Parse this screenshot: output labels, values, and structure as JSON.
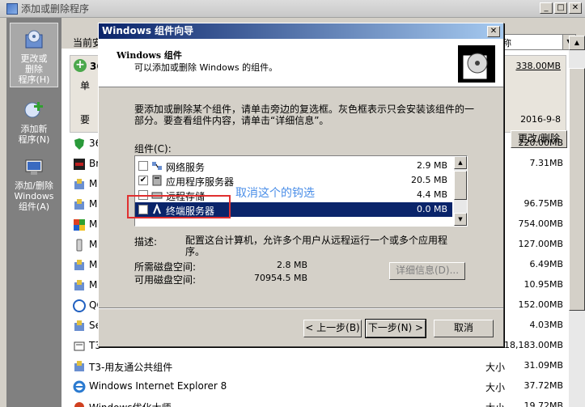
{
  "window": {
    "title": "添加或删除程序"
  },
  "sidebar": {
    "items": [
      {
        "label": "更改或\n删除\n程序(H)"
      },
      {
        "label": "添加新\n程序(N)"
      },
      {
        "label": "添加/删除\nWindows\n组件(A)"
      }
    ]
  },
  "main": {
    "sort_label": "当前安",
    "sort_value": "称",
    "selected_program": {
      "name_visible": "36",
      "size": "338.00MB",
      "date": "2016-9-8",
      "side_text_1": "单",
      "side_text_2": "要",
      "change_button": "更改/删除"
    },
    "programs": [
      {
        "name": "36",
        "label": "",
        "size": "220.00MB"
      },
      {
        "name": "Br",
        "label": "",
        "size": "7.31MB"
      },
      {
        "name": "Ma",
        "label": "",
        "size": ""
      },
      {
        "name": "Mi",
        "label": "",
        "size": "96.75MB"
      },
      {
        "name": "Mi",
        "label": "",
        "size": "754.00MB"
      },
      {
        "name": "Mi",
        "label": "",
        "size": "127.00MB"
      },
      {
        "name": "Mi",
        "label": "",
        "size": "6.49MB"
      },
      {
        "name": "Mi",
        "label": "",
        "size": "10.95MB"
      },
      {
        "name": "QC",
        "label": "",
        "size": "152.00MB"
      },
      {
        "name": "Se",
        "label": "",
        "size": "4.03MB"
      },
      {
        "name": "T3",
        "label": "",
        "size": "18,183.00MB"
      },
      {
        "name": "T3-用友通公共组件",
        "label": "大小",
        "size": "31.09MB"
      },
      {
        "name": "Windows Internet Explorer 8",
        "label": "大小",
        "size": "37.72MB"
      },
      {
        "name": "Windows优化大师",
        "label": "大小",
        "size": "19.72MB"
      }
    ]
  },
  "dialog": {
    "title": "Windows 组件向导",
    "header_title": "Windows 组件",
    "header_subtitle": "可以添加或删除 Windows 的组件。",
    "instructions": "要添加或删除某个组件，请单击旁边的复选框。灰色框表示只会安装该组件的一部分。要查看组件内容，请单击“详细信息”。",
    "components_label": "组件(C):",
    "components": [
      {
        "name": "网络服务",
        "size": "2.9 MB",
        "checked": ""
      },
      {
        "name": "应用程序服务器",
        "size": "20.5 MB",
        "checked": "✔"
      },
      {
        "name": "远程存储",
        "size": "4.4 MB",
        "checked": ""
      },
      {
        "name": "终端服务器",
        "size": "0.0 MB",
        "checked": ""
      }
    ],
    "description_label": "描述:",
    "description": "配置这台计算机，允许多个用户从远程运行一个或多个应用程序。",
    "disk_required_label": "所需磁盘空间:",
    "disk_required": "2.8 MB",
    "disk_available_label": "可用磁盘空间:",
    "disk_available": "70954.5 MB",
    "details_button": "详细信息(D)...",
    "back_button": "< 上一步(B)",
    "next_button": "下一步(N) >",
    "cancel_button": "取消"
  },
  "annotation": {
    "text": "取消这个的钩选",
    "color": "#e03030"
  }
}
